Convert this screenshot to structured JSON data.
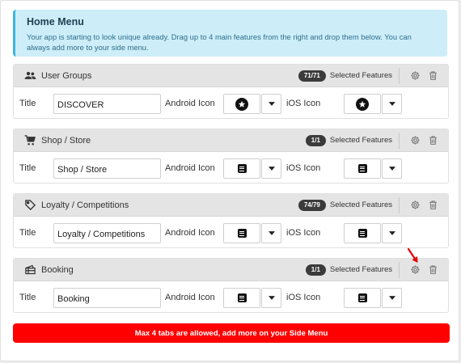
{
  "info": {
    "title": "Home Menu",
    "text": "Your app is starting to look unique already. Drag up to 4 main features from the right and drop them below. You can always add more to your side menu."
  },
  "labels": {
    "title": "Title",
    "android_icon": "Android Icon",
    "ios_icon": "iOS Icon",
    "selected_features": "Selected Features"
  },
  "tabs": [
    {
      "label": "User Groups",
      "badge": "71/71",
      "title_value": "DISCOVER",
      "head_icon": "users-icon",
      "android_icon": "star-icon",
      "ios_icon": "star-icon"
    },
    {
      "label": "Shop / Store",
      "badge": "1/1",
      "title_value": "Shop / Store",
      "head_icon": "cart-icon",
      "android_icon": "note-icon",
      "ios_icon": "note-icon"
    },
    {
      "label": "Loyalty / Competitions",
      "badge": "74/79",
      "title_value": "Loyalty / Competitions",
      "head_icon": "tag-icon",
      "android_icon": "note-icon",
      "ios_icon": "note-icon"
    },
    {
      "label": "Booking",
      "badge": "1/1",
      "title_value": "Booking",
      "head_icon": "ticket-icon",
      "android_icon": "note-icon",
      "ios_icon": "note-icon"
    }
  ],
  "footer": {
    "message": "Max 4 tabs are allowed, add more on your Side Menu"
  },
  "colors": {
    "info_bg": "#cdeef8",
    "info_border": "#3cb6e0",
    "badge_bg": "#3b3b3b",
    "alert_red": "#ff0000"
  }
}
